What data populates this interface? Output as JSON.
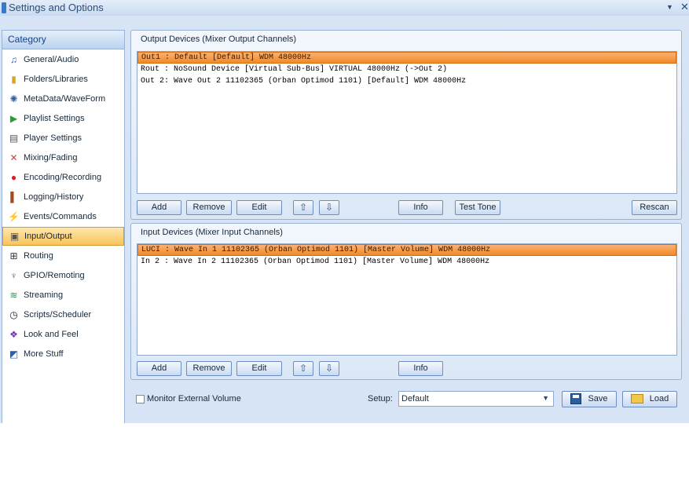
{
  "window": {
    "title": "Settings and Options",
    "pin_glyph": "▼",
    "close_glyph": "✕"
  },
  "sidebar": {
    "header": "Category",
    "items": [
      {
        "label": "General/Audio",
        "icon": "music-note-icon",
        "glyph": "♫",
        "color": "#2d63b0"
      },
      {
        "label": "Folders/Libraries",
        "icon": "folder-icon",
        "glyph": "▮",
        "color": "#d9a520"
      },
      {
        "label": "MetaData/WaveForm",
        "icon": "waveform-icon",
        "glyph": "✺",
        "color": "#3a5f9e"
      },
      {
        "label": "Playlist Settings",
        "icon": "playlist-icon",
        "glyph": "▶",
        "color": "#2e9b3a"
      },
      {
        "label": "Player Settings",
        "icon": "player-icon",
        "glyph": "▤",
        "color": "#555555"
      },
      {
        "label": "Mixing/Fading",
        "icon": "crossfade-icon",
        "glyph": "✕",
        "color": "#d04040"
      },
      {
        "label": "Encoding/Recording",
        "icon": "record-icon",
        "glyph": "●",
        "color": "#d42020"
      },
      {
        "label": "Logging/History",
        "icon": "book-icon",
        "glyph": "▌",
        "color": "#a64a1e"
      },
      {
        "label": "Events/Commands",
        "icon": "lightning-icon",
        "glyph": "⚡",
        "color": "#e3a10d"
      },
      {
        "label": "Input/Output",
        "icon": "io-icon",
        "glyph": "▣",
        "color": "#555555"
      },
      {
        "label": "Routing",
        "icon": "routing-icon",
        "glyph": "⊞",
        "color": "#333333"
      },
      {
        "label": "GPIO/Remoting",
        "icon": "gpio-icon",
        "glyph": "♆",
        "color": "#666666"
      },
      {
        "label": "Streaming",
        "icon": "broadcast-icon",
        "glyph": "≋",
        "color": "#2e8b57"
      },
      {
        "label": "Scripts/Scheduler",
        "icon": "clock-icon",
        "glyph": "◷",
        "color": "#222222"
      },
      {
        "label": "Look and Feel",
        "icon": "palette-icon",
        "glyph": "❖",
        "color": "#7a2fb5"
      },
      {
        "label": "More Stuff",
        "icon": "more-stuff-icon",
        "glyph": "◩",
        "color": "#2a5fa8"
      }
    ],
    "active_index": 9
  },
  "output": {
    "title": "Output Devices (Mixer Output Channels)",
    "rows": [
      "Out1 : Default [Default] WDM 48000Hz",
      "Rout : NoSound Device [Virtual Sub-Bus] VIRTUAL 48000Hz (->Out 2)",
      "Out 2: Wave Out 2 11102365 (Orban Optimod 1101) [Default] WDM 48000Hz"
    ],
    "selected_index": 0,
    "buttons": {
      "add": "Add",
      "remove": "Remove",
      "edit": "Edit",
      "up": "⇧",
      "down": "⇩",
      "info": "Info",
      "test_tone": "Test Tone",
      "rescan": "Rescan"
    }
  },
  "input": {
    "title": "Input Devices (Mixer Input Channels)",
    "rows": [
      "LUCI : Wave In 1 11102365 (Orban Optimod 1101) [Master Volume] WDM 48000Hz",
      "In 2 : Wave In 2 11102365 (Orban Optimod 1101) [Master Volume] WDM 48000Hz"
    ],
    "selected_index": 0,
    "buttons": {
      "add": "Add",
      "remove": "Remove",
      "edit": "Edit",
      "up": "⇧",
      "down": "⇩",
      "info": "Info"
    }
  },
  "bottom": {
    "monitor_label": "Monitor External Volume",
    "monitor_checked": false,
    "setup_label": "Setup:",
    "setup_value": "Default",
    "setup_arrow": "▼",
    "save": "Save",
    "load": "Load"
  }
}
